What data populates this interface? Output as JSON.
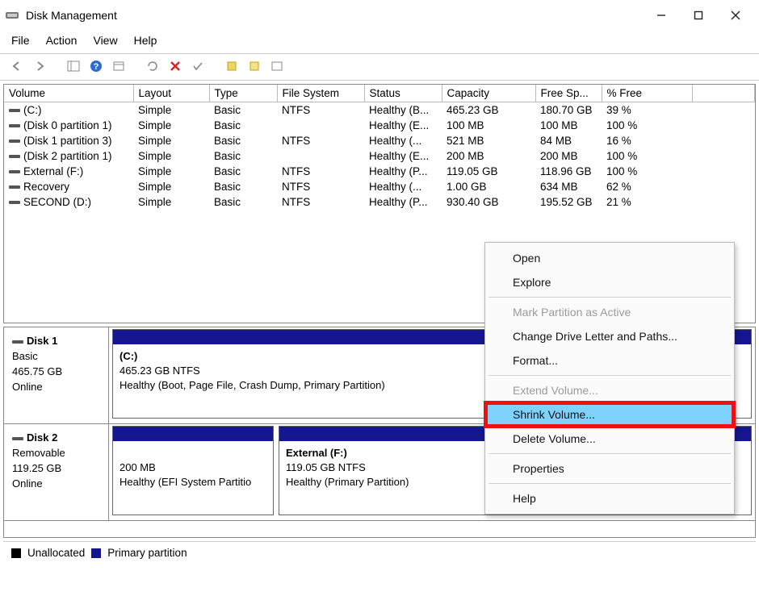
{
  "window": {
    "title": "Disk Management"
  },
  "menu": {
    "file": "File",
    "action": "Action",
    "view": "View",
    "help": "Help"
  },
  "columns": {
    "volume": "Volume",
    "layout": "Layout",
    "type": "Type",
    "fs": "File System",
    "status": "Status",
    "capacity": "Capacity",
    "free": "Free Sp...",
    "pctfree": "% Free"
  },
  "volumes": [
    {
      "name": "(C:)",
      "layout": "Simple",
      "type": "Basic",
      "fs": "NTFS",
      "status": "Healthy (B...",
      "capacity": "465.23 GB",
      "free": "180.70 GB",
      "pct": "39 %"
    },
    {
      "name": "(Disk 0 partition 1)",
      "layout": "Simple",
      "type": "Basic",
      "fs": "",
      "status": "Healthy (E...",
      "capacity": "100 MB",
      "free": "100 MB",
      "pct": "100 %"
    },
    {
      "name": "(Disk 1 partition 3)",
      "layout": "Simple",
      "type": "Basic",
      "fs": "NTFS",
      "status": "Healthy (...",
      "capacity": "521 MB",
      "free": "84 MB",
      "pct": "16 %"
    },
    {
      "name": "(Disk 2 partition 1)",
      "layout": "Simple",
      "type": "Basic",
      "fs": "",
      "status": "Healthy (E...",
      "capacity": "200 MB",
      "free": "200 MB",
      "pct": "100 %"
    },
    {
      "name": "External  (F:)",
      "layout": "Simple",
      "type": "Basic",
      "fs": "NTFS",
      "status": "Healthy (P...",
      "capacity": "119.05 GB",
      "free": "118.96 GB",
      "pct": "100 %"
    },
    {
      "name": "Recovery",
      "layout": "Simple",
      "type": "Basic",
      "fs": "NTFS",
      "status": "Healthy (...",
      "capacity": "1.00 GB",
      "free": "634 MB",
      "pct": "62 %"
    },
    {
      "name": "SECOND (D:)",
      "layout": "Simple",
      "type": "Basic",
      "fs": "NTFS",
      "status": "Healthy (P...",
      "capacity": "930.40 GB",
      "free": "195.52 GB",
      "pct": "21 %"
    }
  ],
  "disks": {
    "disk1": {
      "label": "Disk 1",
      "type": "Basic",
      "size": "465.75 GB",
      "state": "Online",
      "vol": {
        "name": "(C:)",
        "line2": "465.23 GB NTFS",
        "line3": "Healthy (Boot, Page File, Crash Dump, Primary Partition)"
      }
    },
    "disk2": {
      "label": "Disk 2",
      "type": "Removable",
      "size": "119.25 GB",
      "state": "Online",
      "vol1": {
        "line2": "200 MB",
        "line3": "Healthy (EFI System Partitio"
      },
      "vol2": {
        "name": "External  (F:)",
        "line2": "119.05 GB NTFS",
        "line3": "Healthy (Primary Partition)"
      }
    }
  },
  "legend": {
    "unalloc": "Unallocated",
    "primary": "Primary partition"
  },
  "context": {
    "open": "Open",
    "explore": "Explore",
    "mark_active": "Mark Partition as Active",
    "change_letter": "Change Drive Letter and Paths...",
    "format": "Format...",
    "extend": "Extend Volume...",
    "shrink": "Shrink Volume...",
    "delete": "Delete Volume...",
    "properties": "Properties",
    "help": "Help"
  }
}
